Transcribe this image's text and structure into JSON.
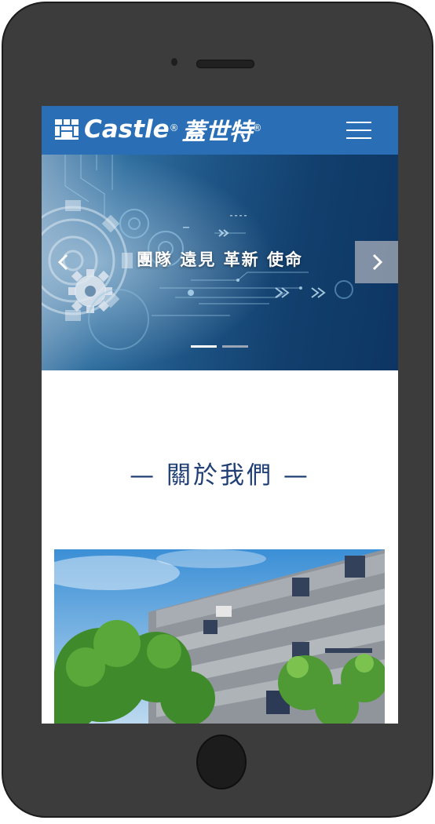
{
  "header": {
    "logo_text": "Castle",
    "logo_cn": "蓋世特",
    "logo_reg": "®",
    "menu_icon": "hamburger-menu-icon"
  },
  "hero": {
    "slogan": "團隊 遠見 革新 使命",
    "prev_icon": "chevron-left-icon",
    "next_icon": "chevron-right-icon",
    "slide_count": 2,
    "active_slide": 1
  },
  "about": {
    "title": "— 關於我們 —"
  },
  "colors": {
    "brand_blue": "#2a6fb5",
    "title_navy": "#1f3f75"
  }
}
